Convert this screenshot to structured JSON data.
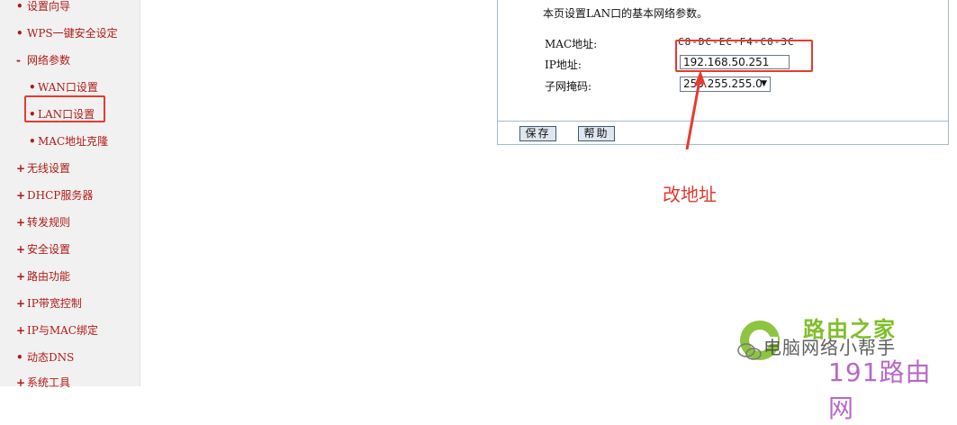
{
  "sidebar": {
    "items": [
      {
        "bullet": "•",
        "label": "设置向导"
      },
      {
        "bullet": "•",
        "label": "WPS一键安全设定"
      },
      {
        "bullet": "-",
        "label": "网络参数"
      },
      {
        "bullet": "•",
        "label": "WAN口设置"
      },
      {
        "bullet": "•",
        "label": "LAN口设置"
      },
      {
        "bullet": "•",
        "label": "MAC地址克隆"
      },
      {
        "bullet": "+",
        "label": "无线设置"
      },
      {
        "bullet": "+",
        "label": "DHCP服务器"
      },
      {
        "bullet": "+",
        "label": "转发规则"
      },
      {
        "bullet": "+",
        "label": "安全设置"
      },
      {
        "bullet": "+",
        "label": "路由功能"
      },
      {
        "bullet": "+",
        "label": "IP带宽控制"
      },
      {
        "bullet": "+",
        "label": "IP与MAC绑定"
      },
      {
        "bullet": "•",
        "label": "动态DNS"
      },
      {
        "bullet": "+",
        "label": "系统工具"
      }
    ]
  },
  "panel": {
    "description": "本页设置LAN口的基本网络参数。",
    "mac_label": "MAC地址:",
    "mac_value": "C8-DC-EC-F4-C0-3C",
    "ip_label": "IP地址:",
    "ip_value": "192.168.50.251",
    "mask_label": "子网掩码:",
    "mask_value": "255.255.255.0",
    "save_label": "保存",
    "help_label": "帮助"
  },
  "annotation": "改地址",
  "watermark": {
    "title": "路由之家",
    "subtitle": "电脑网络小帮手",
    "site": "191路由网"
  },
  "colors": {
    "nav_text": "#b01b16",
    "highlight_box": "#e63b2e",
    "annotation": "#e0392b",
    "watermark_green": "#7fbf2a",
    "watermark_purple": "#b768c8"
  }
}
